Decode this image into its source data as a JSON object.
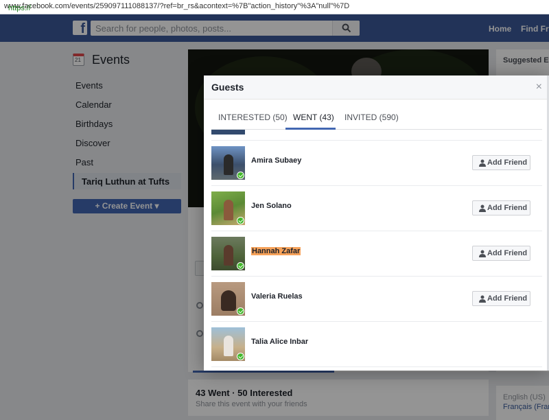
{
  "browser": {
    "url_protocol": "https://",
    "url_rest": "www.facebook.com/events/259097111088137/?ref=br_rs&acontext=%7B\"action_history\"%3A\"null\"%7D"
  },
  "topnav": {
    "logo": "f",
    "search_placeholder": "Search for people, photos, posts...",
    "home_label": "Home",
    "find_friends_label": "Find Fri"
  },
  "sidebar": {
    "calendar_day": "21",
    "title": "Events",
    "items": [
      {
        "label": "Events"
      },
      {
        "label": "Calendar"
      },
      {
        "label": "Birthdays"
      },
      {
        "label": "Discover"
      },
      {
        "label": "Past"
      }
    ],
    "active_item": "Tariq Luthun at Tufts",
    "create_button": "+ Create Event ▾"
  },
  "event": {
    "stats": "43 Went · 50 Interested",
    "share_text": "Share this event with your friends"
  },
  "right_column": {
    "suggested": "Suggested Ev",
    "lang_1": "English (US)",
    "lang_2": "Français (Fran"
  },
  "modal": {
    "title": "Guests",
    "close": "×",
    "tabs": [
      {
        "label": "INTERESTED (50)",
        "active": false
      },
      {
        "label": "WENT (43)",
        "active": true
      },
      {
        "label": "INVITED (590)",
        "active": false
      }
    ],
    "add_friend_label": "Add Friend",
    "guests": [
      {
        "name": "Amira Subaey",
        "highlighted": false,
        "has_button": true
      },
      {
        "name": "Jen Solano",
        "highlighted": false,
        "has_button": true
      },
      {
        "name": "Hannah Zafar",
        "highlighted": true,
        "has_button": true
      },
      {
        "name": "Valeria Ruelas",
        "highlighted": false,
        "has_button": true
      },
      {
        "name": "Talia Alice Inbar",
        "highlighted": false,
        "has_button": false
      }
    ]
  },
  "colors": {
    "nav_blue": "#3b5998",
    "button_blue": "#4267b2",
    "highlight": "#f6a25a",
    "went_check": "#42b72a"
  }
}
